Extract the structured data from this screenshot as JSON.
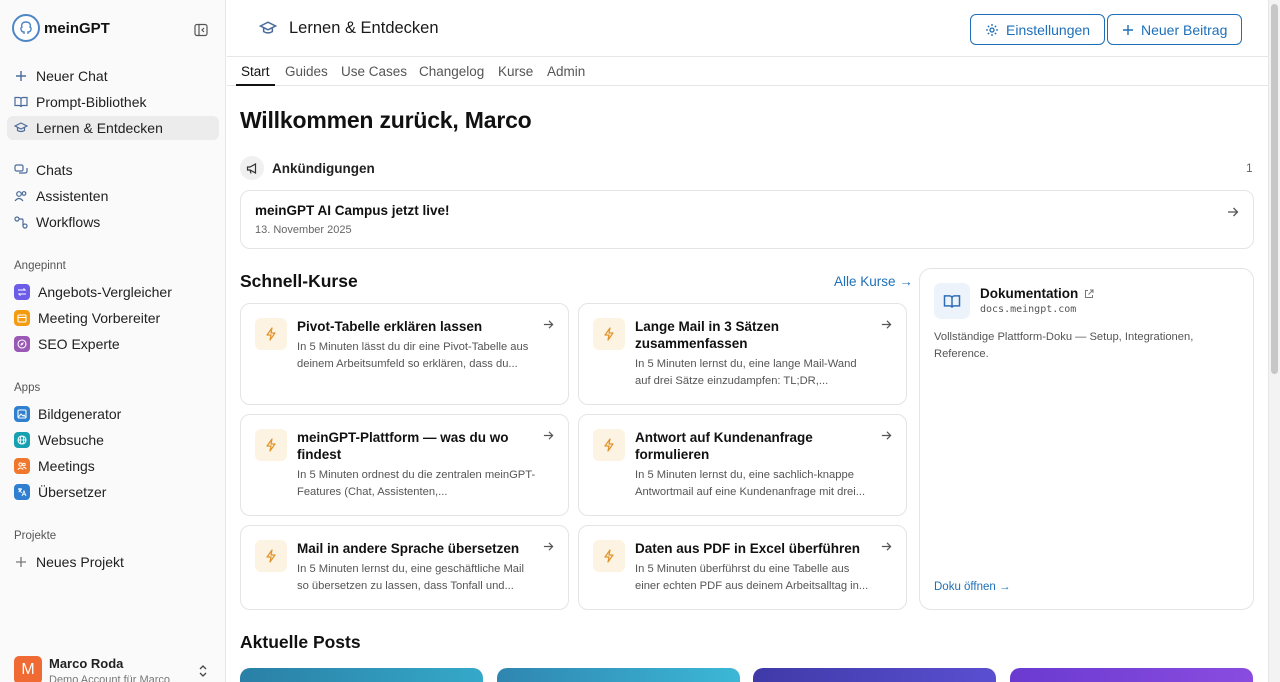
{
  "app": {
    "name": "meinGPT"
  },
  "sidebar": {
    "main_nav": [
      {
        "label": "Neuer Chat",
        "icon": "plus-icon"
      },
      {
        "label": "Prompt-Bibliothek",
        "icon": "book-icon"
      },
      {
        "label": "Lernen & Entdecken",
        "icon": "graduation-cap-icon",
        "active": true
      }
    ],
    "secondary_nav": [
      {
        "label": "Chats",
        "icon": "chats-icon"
      },
      {
        "label": "Assistenten",
        "icon": "users-icon"
      },
      {
        "label": "Workflows",
        "icon": "workflow-icon"
      }
    ],
    "pinned_label": "Angepinnt",
    "pinned": [
      {
        "label": "Angebots-Vergleicher",
        "color": "#6c5ce7"
      },
      {
        "label": "Meeting Vorbereiter",
        "color": "#f39c12"
      },
      {
        "label": "SEO Experte",
        "color": "#9b59b6"
      }
    ],
    "apps_label": "Apps",
    "apps": [
      {
        "label": "Bildgenerator",
        "color": "#2f80d0"
      },
      {
        "label": "Websuche",
        "color": "#16a0b0"
      },
      {
        "label": "Meetings",
        "color": "#f0782d"
      },
      {
        "label": "Übersetzer",
        "color": "#2f80d0"
      }
    ],
    "projects_label": "Projekte",
    "new_project": "Neues Projekt",
    "user": {
      "initial": "M",
      "name": "Marco Roda",
      "subtitle": "Demo Account für Marco"
    }
  },
  "header": {
    "title": "Lernen & Entdecken",
    "settings_label": "Einstellungen",
    "new_post_label": "Neuer Beitrag"
  },
  "tabs": [
    "Start",
    "Guides",
    "Use Cases",
    "Changelog",
    "Kurse",
    "Admin"
  ],
  "main": {
    "welcome": "Willkommen zurück, Marco",
    "announcements": {
      "title": "Ankündigungen",
      "count": "1",
      "item_title": "meinGPT AI Campus jetzt live!",
      "item_date": "13. November 2025"
    },
    "quick_courses": {
      "title": "Schnell-Kurse",
      "all_link": "Alle Kurse →",
      "items": [
        {
          "title": "Pivot-Tabelle erklären lassen",
          "desc": "In 5 Minuten lässt du dir eine Pivot-Tabelle aus deinem Arbeitsumfeld so erklären, dass du..."
        },
        {
          "title": "Lange Mail in 3 Sätzen zusammenfassen",
          "desc": "In 5 Minuten lernst du, eine lange Mail-Wand auf drei Sätze einzudampfen: TL;DR,..."
        },
        {
          "title": "meinGPT-Plattform — was du wo findest",
          "desc": "In 5 Minuten ordnest du die zentralen meinGPT-Features (Chat, Assistenten,..."
        },
        {
          "title": "Antwort auf Kundenanfrage formulieren",
          "desc": "In 5 Minuten lernst du, eine sachlich-knappe Antwortmail auf eine Kundenanfrage mit drei..."
        },
        {
          "title": "Mail in andere Sprache übersetzen",
          "desc": "In 5 Minuten lernst du, eine geschäftliche Mail so übersetzen zu lassen, dass Tonfall und..."
        },
        {
          "title": "Daten aus PDF in Excel überführen",
          "desc": "In 5 Minuten überführst du eine Tabelle aus einer echten PDF aus deinem Arbeitsalltag in..."
        }
      ]
    },
    "docs": {
      "title": "Dokumentation",
      "url": "docs.meingpt.com",
      "desc": "Vollständige Plattform-Doku — Setup, Integrationen, Reference.",
      "open_link": "Doku öffnen →"
    },
    "posts_title": "Aktuelle Posts"
  },
  "colors": {
    "accent": "#1e6fb8",
    "bolt": "#e0932b"
  }
}
